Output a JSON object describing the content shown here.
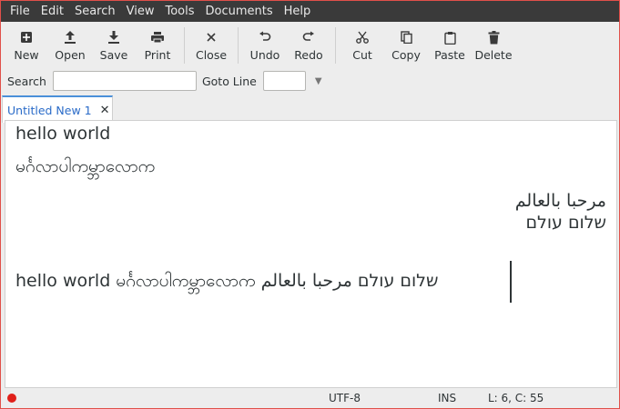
{
  "menubar": {
    "items": [
      {
        "label": "File"
      },
      {
        "label": "Edit"
      },
      {
        "label": "Search"
      },
      {
        "label": "View"
      },
      {
        "label": "Tools"
      },
      {
        "label": "Documents"
      },
      {
        "label": "Help"
      }
    ]
  },
  "toolbar": {
    "new": "New",
    "open": "Open",
    "save": "Save",
    "print": "Print",
    "close": "Close",
    "undo": "Undo",
    "redo": "Redo",
    "cut": "Cut",
    "copy": "Copy",
    "paste": "Paste",
    "delete": "Delete"
  },
  "searchbar": {
    "search_label": "Search",
    "search_value": "",
    "goto_label": "Goto Line",
    "goto_value": ""
  },
  "tabs": [
    {
      "label": "Untitled New 1",
      "active": true
    }
  ],
  "editor": {
    "lines": [
      "hello world",
      "မင်္ဂလာပါကမ္ဘာလောက",
      "مرحبا بالعالم",
      "שלום עולם",
      "",
      "hello world မင်္ဂလာပါကမ္ဘာလောက שלום עולם مرحبا بالعالم"
    ]
  },
  "statusbar": {
    "modified_indicator_color": "#e0201a",
    "encoding": "UTF-8",
    "mode": "INS",
    "position": "L: 6, C: 55"
  }
}
